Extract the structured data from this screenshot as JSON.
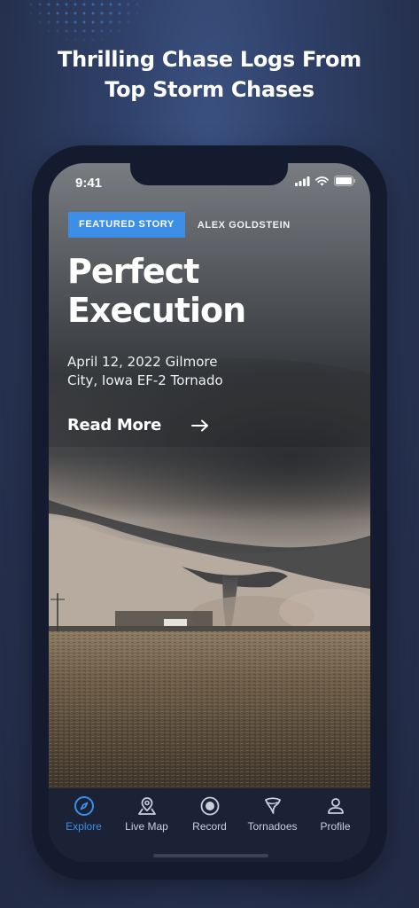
{
  "promo": {
    "headline_line1": "Thrilling Chase Logs From",
    "headline_line2": "Top Storm Chases"
  },
  "status_bar": {
    "time": "9:41"
  },
  "story": {
    "tag": "FEATURED STORY",
    "author": "ALEX GOLDSTEIN",
    "title_line1": "Perfect",
    "title_line2": "Execution",
    "subtitle": "April 12, 2022 Gilmore City, Iowa EF-2 Tornado",
    "read_more": "Read More"
  },
  "tabbar": {
    "items": [
      {
        "label": "Explore",
        "icon": "compass-icon",
        "active": true
      },
      {
        "label": "Live Map",
        "icon": "map-pin-icon",
        "active": false
      },
      {
        "label": "Record",
        "icon": "record-icon",
        "active": false
      },
      {
        "label": "Tornadoes",
        "icon": "tornado-icon",
        "active": false
      },
      {
        "label": "Profile",
        "icon": "profile-icon",
        "active": false
      }
    ]
  },
  "colors": {
    "accent": "#3d8ee6",
    "background": "#2e3f66",
    "tabbar": "#1b2236"
  }
}
